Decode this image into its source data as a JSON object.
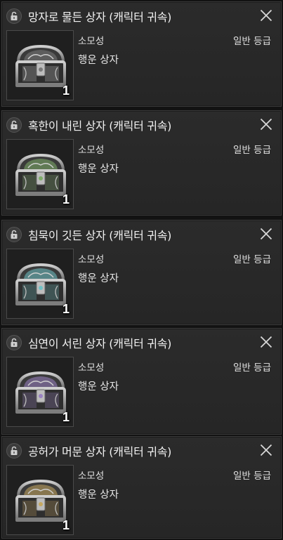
{
  "cards": [
    {
      "title": "망자로 물든 상자 (캐릭터 귀속)",
      "material": "소모성",
      "grade": "일반 등급",
      "item_name": "행운 상자",
      "quantity": "1",
      "accent": "#9a9a9a",
      "gem": "#7a7a7a"
    },
    {
      "title": "혹한이 내린 상자 (캐릭터 귀속)",
      "material": "소모성",
      "grade": "일반 등급",
      "item_name": "행운 상자",
      "quantity": "1",
      "accent": "#6f8f62",
      "gem": "#7fae6a"
    },
    {
      "title": "침묵이 깃든 상자 (캐릭터 귀속)",
      "material": "소모성",
      "grade": "일반 등급",
      "item_name": "행운 상자",
      "quantity": "1",
      "accent": "#5f9a9a",
      "gem": "#6fc2c6"
    },
    {
      "title": "심연이 서린 상자 (캐릭터 귀속)",
      "material": "소모성",
      "grade": "일반 등급",
      "item_name": "행운 상자",
      "quantity": "1",
      "accent": "#7e6c9a",
      "gem": "#9a82c2"
    },
    {
      "title": "공허가 머문 상자 (캐릭터 귀속)",
      "material": "소모성",
      "grade": "일반 등급",
      "item_name": "행운 상자",
      "quantity": "1",
      "accent": "#9a8250",
      "gem": "#c6a860"
    }
  ],
  "icons": {
    "lock": "unlock-icon",
    "close": "close-icon",
    "chest": "treasure-chest-icon"
  }
}
